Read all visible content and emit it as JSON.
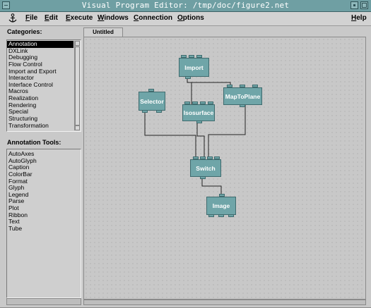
{
  "window": {
    "title": "Visual Program Editor: /tmp/doc/figure2.net"
  },
  "menubar": {
    "items": [
      {
        "label": "File",
        "underline": "F",
        "rest": "ile"
      },
      {
        "label": "Edit",
        "underline": "E",
        "rest": "dit"
      },
      {
        "label": "Execute",
        "underline": "E",
        "rest": "xecute"
      },
      {
        "label": "Windows",
        "underline": "W",
        "rest": "indows"
      },
      {
        "label": "Connection",
        "underline": "C",
        "rest": "onnection"
      },
      {
        "label": "Options",
        "underline": "O",
        "rest": "ptions"
      }
    ],
    "help": {
      "label": "Help",
      "underline": "H",
      "rest": "elp"
    }
  },
  "categories": {
    "label": "Categories:",
    "items": [
      "Annotation",
      "DXLink",
      "Debugging",
      "Flow Control",
      "Import and Export",
      "Interactor",
      "Interface Control",
      "Macros",
      "Realization",
      "Rendering",
      "Special",
      "Structuring",
      "Transformation"
    ],
    "selected": "Annotation"
  },
  "tools": {
    "label": "Annotation Tools:",
    "items": [
      "AutoAxes",
      "AutoGlyph",
      "Caption",
      "ColorBar",
      "Format",
      "Glyph",
      "Legend",
      "Parse",
      "Plot",
      "Ribbon",
      "Text",
      "Tube"
    ]
  },
  "canvas": {
    "tab_label": "Untitled",
    "nodes": {
      "import": "Import",
      "selector": "Selector",
      "isosurface": "Isosurface",
      "maptoplane": "MapToPlane",
      "switch": "Switch",
      "image": "Image"
    }
  },
  "colors": {
    "titlebar": "#6f9fa3",
    "node": "#6fa5a8",
    "background": "#c9c9c9"
  }
}
